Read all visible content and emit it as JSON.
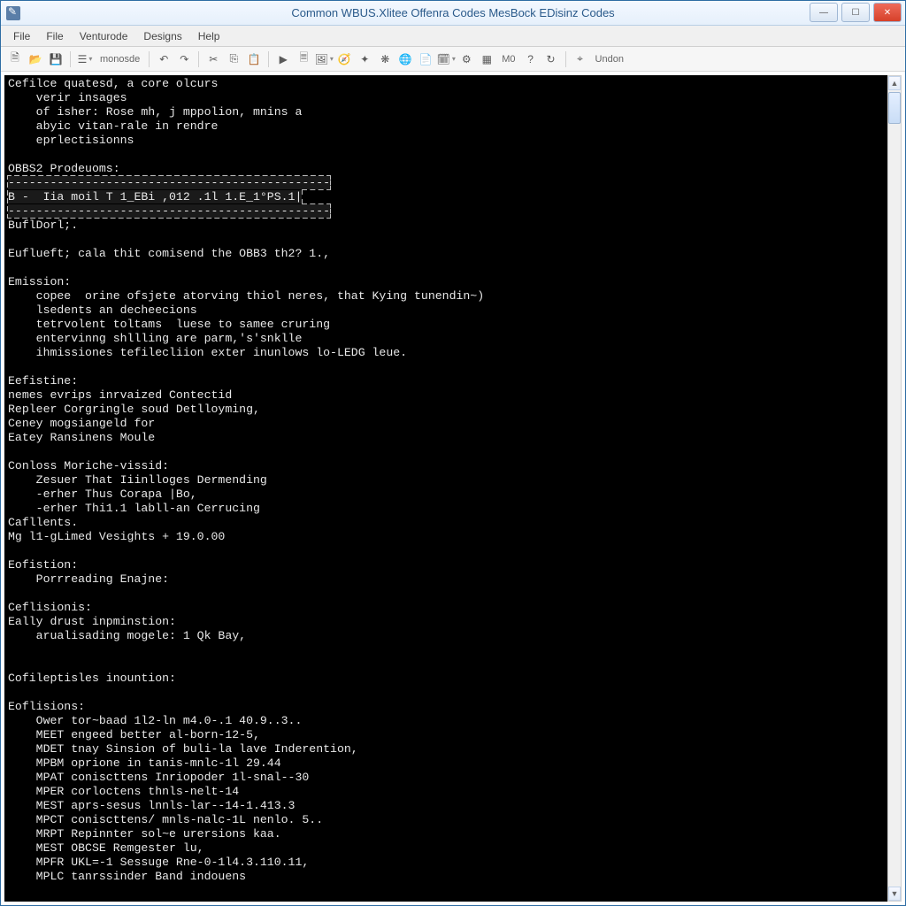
{
  "title": "Common WBUS.Xlitee Offenra Codes MesBock EDisinz Codes",
  "menus": [
    "File",
    "File",
    "Venturode",
    "Designs",
    "Help"
  ],
  "toolbar_text": {
    "mode": "monosde",
    "m0": "M0",
    "suffix": "Undon"
  },
  "console_lines": [
    "Cefilce quatesd, a core olcurs",
    "    verir insages",
    "    of isher: Rose mh, j mppolion, mnins a",
    "    abyic vitan-rale in rendre",
    "    eprlectisionns",
    "",
    "OBBS2 Prodeuoms:",
    "__HL_START__",
    "B -  Iia moil T 1_EBi ,012 .1l 1.E_1°PS.1|",
    "__HL_END__",
    "BuflDorl;.",
    "",
    "Euflueft; cala thit comisend the OBB3 th2? 1.,",
    "",
    "Emission:",
    "    copee  orine ofsjete atorving thiol neres, that Kying tunendin~)",
    "    lsedents an decheecions",
    "    tetrvolent toltams  luese to samee cruring",
    "    entervinng shllling are parm,'s'snklle",
    "    ihmissiones tefilecliion exter inunlows lo-LEDG leue.",
    "",
    "Eefistine:",
    "nemes evrips inrvaized Contectid",
    "Repleer Corgringle soud Detlloyming,",
    "Ceney mogsiangeld for",
    "Eatey Ransinens Moule",
    "",
    "Conloss Moriche-vissid:",
    "    Zesuer That Iiinlloges Dermending",
    "    -erher Thus Corapa |Bo,",
    "    -erher Thi1.1 labll-an Cerrucing",
    "Cafllents.",
    "Mg l1-gLimed Vesights + 19.0.00",
    "",
    "Eofistion:",
    "    Porrreading Enajne:",
    "",
    "Ceflisionis:",
    "Eally drust inpminstion:",
    "    arualisading mogele: 1 Qk Bay,",
    "",
    "",
    "Cofileptisles inountion:",
    "",
    "Eoflisions:",
    "    Ower tor~baad 1l2-ln m4.0-.1 40.9..3..",
    "    MEET engeed better al-born-12-5,",
    "    MDET tnay Sinsion of buli-la lave Inderention,",
    "    MPBM oprione in tanis-mnlc-1l 29.44",
    "    MPAT coniscttens Inriopoder 1l-snal--30",
    "    MPER corloctens thnls-nelt-14",
    "    MEST aprs-sesus lnnls-lar--14-1.413.3",
    "    MPCT coniscttens/ mnls-nalc-1L nenlo. 5..",
    "    MRPT Repinnter sol~e urersions kaa.",
    "    MEST OBCSE Remgester lu,",
    "    MPFR UKL=-1 Sessuge Rne-0-1l4.3.110.11,",
    "    MPLC tanrssinder Band indouens"
  ],
  "icons": {
    "min": "—",
    "max": "☐",
    "close": "✕"
  }
}
